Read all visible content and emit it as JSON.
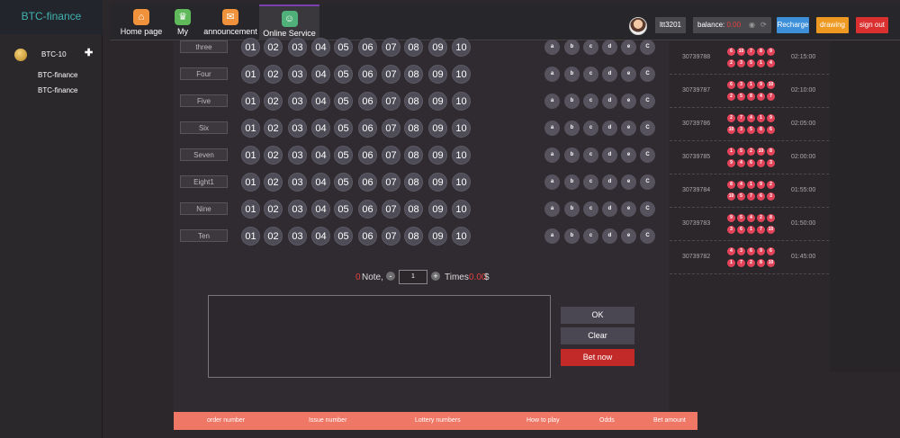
{
  "brand": "BTC-finance",
  "sidebar": {
    "lottery": "BTC-10",
    "links": [
      "BTC-finance",
      "BTC-finance"
    ]
  },
  "nav": [
    {
      "label": "Home page",
      "icon": "home-icon",
      "color": "#f0923b"
    },
    {
      "label": "My",
      "icon": "crown-icon",
      "color": "#5fb95a"
    },
    {
      "label": "announcement",
      "icon": "mail-icon",
      "color": "#f0923b"
    },
    {
      "label": "Online Service",
      "icon": "support-icon",
      "color": "#4fb07a"
    }
  ],
  "header": {
    "username": "ltt3201",
    "balance_label": "balance:",
    "balance_value": "0.00",
    "recharge": "Recharge",
    "drawing": "drawing",
    "signout": "sign out"
  },
  "board": {
    "rows": [
      "three",
      "Four",
      "Five",
      "Six",
      "Seven",
      "Eight1",
      "Nine",
      "Ten"
    ],
    "numbers": [
      "01",
      "02",
      "03",
      "04",
      "05",
      "06",
      "07",
      "08",
      "09",
      "10"
    ],
    "shortcuts": [
      "a",
      "b",
      "c",
      "d",
      "e",
      "C"
    ]
  },
  "bet": {
    "note_count": "0",
    "note_label": "Note,",
    "multiple": "1",
    "times_label": "Times",
    "amount": "0.00",
    "currency": "$",
    "ok": "OK",
    "clear": "Clear",
    "bet_now": "Bet now"
  },
  "table_headers": [
    "order number",
    "Issue number",
    "Lottery numbers",
    "How to play",
    "Odds",
    "Bet amount"
  ],
  "history": [
    {
      "issue": "30739788",
      "time": "02:15:00",
      "balls": [
        "6",
        "10",
        "7",
        "8",
        "9",
        "2",
        "3",
        "5",
        "1",
        "4"
      ]
    },
    {
      "issue": "30739787",
      "time": "02:10:00",
      "balls": [
        "6",
        "3",
        "1",
        "9",
        "10",
        "2",
        "5",
        "8",
        "4",
        "7"
      ]
    },
    {
      "issue": "30739786",
      "time": "02:05:00",
      "balls": [
        "2",
        "7",
        "4",
        "1",
        "9",
        "10",
        "3",
        "5",
        "8",
        "6"
      ]
    },
    {
      "issue": "30739785",
      "time": "02:00:00",
      "balls": [
        "1",
        "5",
        "2",
        "10",
        "8",
        "9",
        "4",
        "6",
        "7",
        "3"
      ]
    },
    {
      "issue": "30739784",
      "time": "01:55:00",
      "balls": [
        "8",
        "4",
        "1",
        "9",
        "2",
        "10",
        "5",
        "7",
        "6",
        "3"
      ]
    },
    {
      "issue": "30739783",
      "time": "01:50:00",
      "balls": [
        "9",
        "5",
        "4",
        "2",
        "8",
        "3",
        "6",
        "1",
        "7",
        "10"
      ]
    },
    {
      "issue": "30739782",
      "time": "01:45:00",
      "balls": [
        "4",
        "3",
        "6",
        "9",
        "6",
        "1",
        "7",
        "2",
        "8",
        "10"
      ]
    }
  ]
}
